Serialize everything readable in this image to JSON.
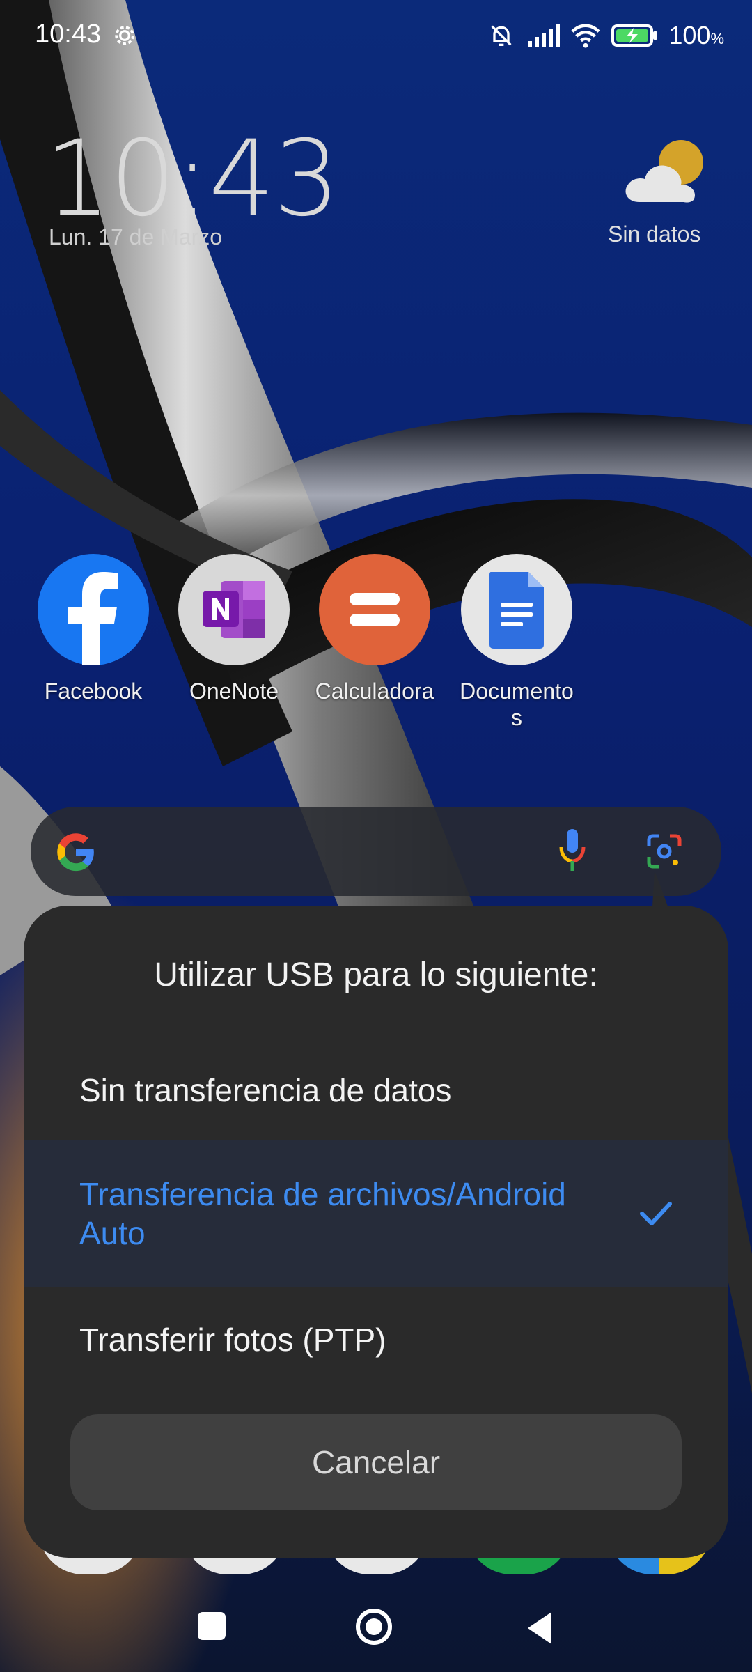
{
  "status_bar": {
    "time": "10:43",
    "battery": "100",
    "battery_unit": "%",
    "icons": [
      "settings-gear-icon",
      "mute-icon",
      "signal-icon",
      "wifi-icon",
      "battery-charging-icon"
    ]
  },
  "clock_widget": {
    "time": "10:43",
    "date": "Lun. 17 de Marzo"
  },
  "weather_widget": {
    "text": "Sin datos",
    "icon": "partly-cloudy-icon"
  },
  "apps": [
    {
      "label": "Facebook",
      "icon": "facebook-icon"
    },
    {
      "label": "OneNote",
      "icon": "onenote-icon"
    },
    {
      "label": "Calculadora",
      "icon": "calculator-icon"
    },
    {
      "label": "Documento\ns",
      "icon": "docs-icon"
    }
  ],
  "search": {
    "icons": [
      "google-g-icon",
      "microphone-icon",
      "google-lens-icon"
    ]
  },
  "dialog": {
    "title": "Utilizar USB para lo siguiente:",
    "options": [
      {
        "label": "Sin transferencia de datos",
        "selected": false
      },
      {
        "label": "Transferencia de archivos/Android Auto",
        "selected": true
      },
      {
        "label": "Transferir fotos (PTP)",
        "selected": false
      }
    ],
    "cancel": "Cancelar"
  },
  "colors": {
    "accent": "#3d8bf0",
    "dialog_bg": "#2a2a2a",
    "selected_bg": "#262c3a"
  },
  "nav": {
    "icons": [
      "recents-square-icon",
      "home-circle-icon",
      "back-triangle-icon"
    ]
  }
}
